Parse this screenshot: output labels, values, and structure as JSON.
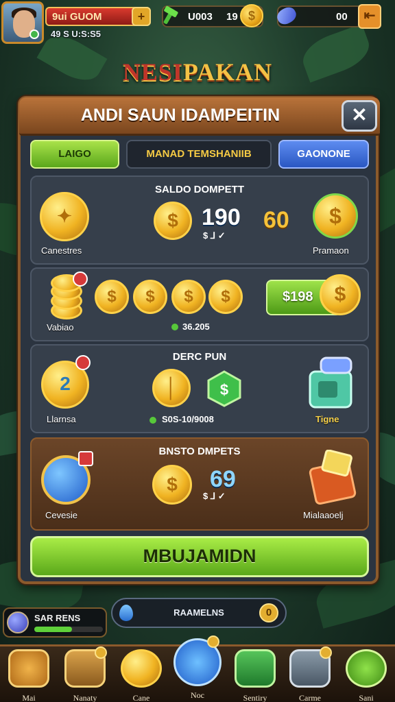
{
  "player": {
    "name": "9ui GUOM",
    "sub": "49 S U:S:S5"
  },
  "resources": {
    "coins_label": "U003",
    "coins_value": "19",
    "gems_value": "00"
  },
  "game_title": {
    "part1": "NESI",
    "part2": "PAKAN"
  },
  "panel": {
    "title": "ANDI SAUN IDAMPEITIN",
    "close": "✕",
    "tabs": [
      "LAIGO",
      "MANAD TEMSHANIIB",
      "GAONONE"
    ]
  },
  "cards": {
    "saldo": {
      "title": "SALDO DOMPETT",
      "left_label": "Canestres",
      "big": "190",
      "big_sub": "$ ⅃ ✓",
      "gold": "60",
      "right_label": "Pramaon"
    },
    "row2": {
      "left_label": "Vabiao",
      "button": "$198",
      "amount": "36.205"
    },
    "derc": {
      "title": "DERC PUN",
      "left_badge": "2",
      "left_label": "Llarnsa",
      "amount": "S0S-10/9008",
      "right_label": "Tigne"
    },
    "bnsto": {
      "title": "BNSTO DMPETS",
      "left_label": "Cevesie",
      "big": "69",
      "big_sub": "$ ⅃ ✓",
      "right_label": "Mialaaoelj"
    }
  },
  "cta": "MBUJAMIDN",
  "hud": {
    "status": "SAR RENS",
    "search": "RAAMELNS",
    "count": "0",
    "progress": 0.55
  },
  "nav": [
    {
      "label": "Mai",
      "icon": "hammer-icon"
    },
    {
      "label": "Nanaty",
      "icon": "chest-icon"
    },
    {
      "label": "Cane",
      "icon": "coin-icon"
    },
    {
      "label": "Noc",
      "icon": "card-icon"
    },
    {
      "label": "Sentiry",
      "icon": "magnifier-icon"
    },
    {
      "label": "Carme",
      "icon": "camera-icon"
    },
    {
      "label": "Sani",
      "icon": "play-icon"
    }
  ],
  "colors": {
    "accent_green": "#5aa81a",
    "panel_brown": "#8c5a2c",
    "gold": "#f0b322",
    "title_red": "#c0352a"
  }
}
